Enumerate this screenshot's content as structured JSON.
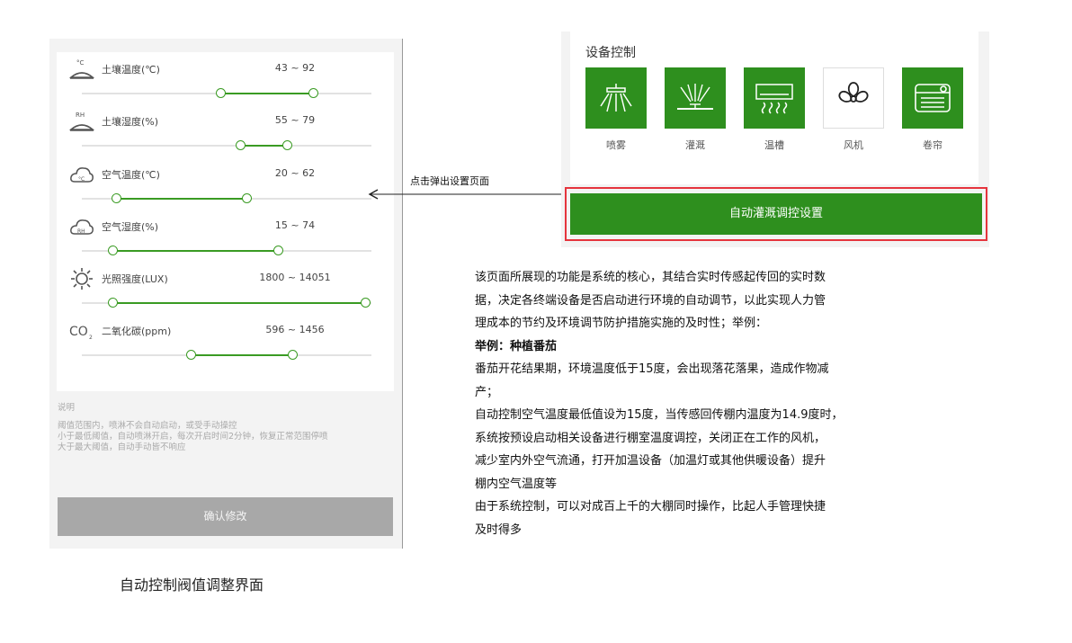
{
  "colors": {
    "accent": "#3a9b23",
    "device_on": "#2e8f1e",
    "highlight_border": "#e5343d",
    "confirm_bg": "#a8a8a8"
  },
  "thresholds": [
    {
      "icon": "soil-temperature-icon",
      "label": "土壤温度(℃)",
      "range": "43 ~ 92",
      "low": 43,
      "high": 92
    },
    {
      "icon": "soil-humidity-icon",
      "label": "土壤湿度(%)",
      "range": "55 ~ 79",
      "low": 55,
      "high": 79
    },
    {
      "icon": "air-temperature-icon",
      "label": "空气温度(℃)",
      "range": "20 ~ 62",
      "low": 20,
      "high": 62
    },
    {
      "icon": "air-humidity-icon",
      "label": "空气湿度(%)",
      "range": "15 ~ 74",
      "low": 15,
      "high": 74
    },
    {
      "icon": "light-intensity-icon",
      "label": "光照强度(LUX)",
      "range": "1800 ~ 14051",
      "low": 1800,
      "high": 14051
    },
    {
      "icon": "co2-icon",
      "label": "二氧化碳(ppm)",
      "range": "596 ~ 1456",
      "low": 596,
      "high": 1456
    }
  ],
  "thresholds_fill": [
    {
      "start": 0.48,
      "end": 0.8
    },
    {
      "start": 0.55,
      "end": 0.71
    },
    {
      "start": 0.12,
      "end": 0.57
    },
    {
      "start": 0.11,
      "end": 0.68
    },
    {
      "start": 0.11,
      "end": 0.98
    },
    {
      "start": 0.38,
      "end": 0.73
    }
  ],
  "note": {
    "title": "说明",
    "lines": [
      "阈值范围内，喷淋不会自动启动，或受手动操控",
      "小于最低阈值，自动喷淋开启，每次开启时间2分钟，恢复正常范围停喷",
      "大于最大阈值，自动手动皆不响应"
    ]
  },
  "confirm_label": "确认修改",
  "left_caption": "自动控制阀值调整界面",
  "device_control": {
    "title": "设备控制",
    "devices": [
      {
        "name": "喷雾",
        "icon": "spray-icon",
        "on": true
      },
      {
        "name": "灌溉",
        "icon": "irrigation-icon",
        "on": true
      },
      {
        "name": "温槽",
        "icon": "heater-icon",
        "on": true
      },
      {
        "name": "风机",
        "icon": "fan-icon",
        "on": false
      },
      {
        "name": "卷帘",
        "icon": "roller-blind-icon",
        "on": true
      }
    ]
  },
  "auto_button_label": "自动灌溉调控设置",
  "popup_label": "点击弹出设置页面",
  "description": [
    "该页面所展现的功能是系统的核心，其结合实时传感起传回的实时数",
    "据，决定各终端设备是否启动进行环境的自动调节，以此实现人力管",
    "理成本的节约及环境调节防护措施实施的及时性；举例：",
    "举例：种植番茄",
    "番茄开花结果期，环境温度低于15度，会出现落花落果，造成作物减",
    "产；",
    "自动控制空气温度最低值设为15度，当传感回传棚内温度为14.9度时，",
    "系统按预设启动相关设备进行棚室温度调控，关闭正在工作的风机，",
    "减少室内外空气流通，打开加温设备（加温灯或其他供暖设备）提升",
    "棚内空气温度等",
    "由于系统控制，可以对成百上千的大棚同时操作，比起人手管理快捷",
    "及时得多"
  ]
}
